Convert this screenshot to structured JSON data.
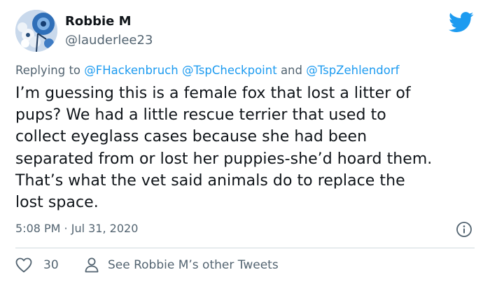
{
  "user": {
    "display_name": "Robbie M",
    "handle": "@lauderlee23"
  },
  "reply": {
    "prefix": "Replying to ",
    "mention_1": "@FHackenbruch",
    "mention_2": "@TspCheckpoint",
    "joiner": " and ",
    "mention_3": "@TspZehlendorf"
  },
  "tweet": {
    "lines": [
      "I’m guessing this is a female fox that lost a litter of",
      "pups? We had a little rescue terrier that used to",
      "collect eyeglass cases because she had been",
      "separated from or lost her puppies-she’d hoard them.",
      "That’s what the vet said animals do to replace the",
      "lost space."
    ],
    "timestamp": "5:08 PM · Jul 31, 2020"
  },
  "actions": {
    "like_count": "30",
    "profile_link": "See Robbie M’s other Tweets"
  },
  "icons": {
    "brand": "twitter-bird-icon",
    "info": "info-icon",
    "like": "heart-icon",
    "profile": "person-icon"
  },
  "colors": {
    "brand_blue": "#1d9bf0",
    "secondary_text": "#536471",
    "primary_text": "#0f1419"
  }
}
